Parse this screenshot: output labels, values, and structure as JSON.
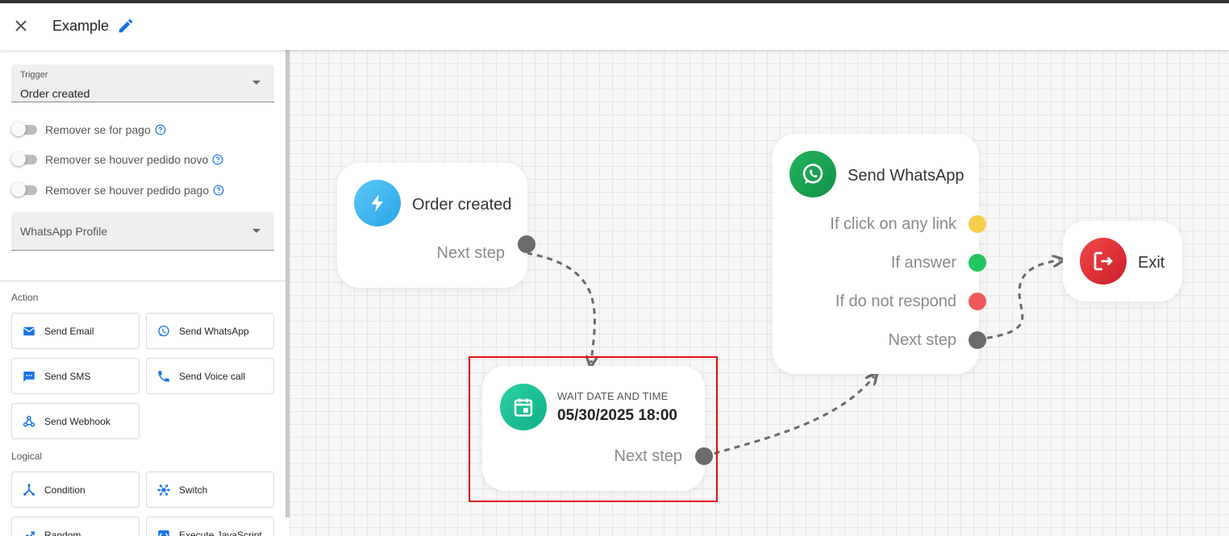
{
  "header": {
    "title": "Example"
  },
  "sidebar": {
    "trigger": {
      "label": "Trigger",
      "value": "Order created"
    },
    "toggles": [
      {
        "label": "Remover se for pago",
        "checked": false
      },
      {
        "label": "Remover se houver pedido novo",
        "checked": false
      },
      {
        "label": "Remover se houver pedido pago",
        "checked": false
      }
    ],
    "whatsapp_profile": {
      "placeholder": "WhatsApp Profile"
    },
    "action_section": "Action",
    "actions": [
      {
        "label": "Send Email",
        "icon": "email-icon"
      },
      {
        "label": "Send WhatsApp",
        "icon": "whatsapp-icon"
      },
      {
        "label": "Send SMS",
        "icon": "sms-icon"
      },
      {
        "label": "Send Voice call",
        "icon": "phone-icon"
      },
      {
        "label": "Send Webhook",
        "icon": "webhook-icon"
      }
    ],
    "logical_section": "Logical",
    "logical": [
      {
        "label": "Condition",
        "icon": "condition-icon"
      },
      {
        "label": "Switch",
        "icon": "switch-icon"
      },
      {
        "label": "Random",
        "icon": "random-icon"
      },
      {
        "label": "Execute JavaScript",
        "icon": "code-icon"
      }
    ]
  },
  "flow": {
    "order_node": {
      "title": "Order created",
      "next_label": "Next step",
      "icon": "lightning-icon"
    },
    "wait_node": {
      "caption": "WAIT DATE AND TIME",
      "date": "05/30/2025 18:00",
      "next_label": "Next step",
      "icon": "calendar-icon"
    },
    "whatsapp_node": {
      "title": "Send WhatsApp",
      "icon": "whatsapp-icon",
      "outputs": [
        {
          "label": "If click on any link",
          "color": "#f9cd4c"
        },
        {
          "label": "If answer",
          "color": "#22c55e"
        },
        {
          "label": "If do not respond",
          "color": "#f05a5a"
        },
        {
          "label": "Next step",
          "color": "#6b6b6b"
        }
      ]
    },
    "exit_node": {
      "title": "Exit",
      "icon": "exit-icon"
    }
  },
  "colors": {
    "accent": "#1a73e8",
    "port_default": "#6b6b6b",
    "selection": "#dd1111"
  }
}
